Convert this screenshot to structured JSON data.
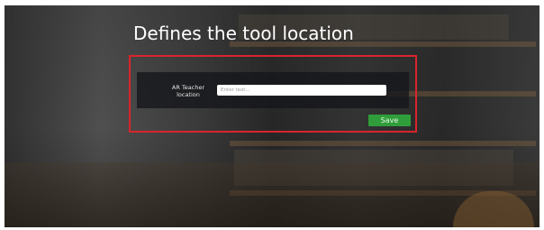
{
  "page": {
    "title": "Defines the tool location"
  },
  "form": {
    "label": "AR Teacher location",
    "input_placeholder": "Enter text...",
    "input_value": "",
    "save_label": "Save"
  },
  "colors": {
    "highlight_border": "#d9252b",
    "save_button": "#2f9e3a",
    "panel": "#14161a"
  }
}
